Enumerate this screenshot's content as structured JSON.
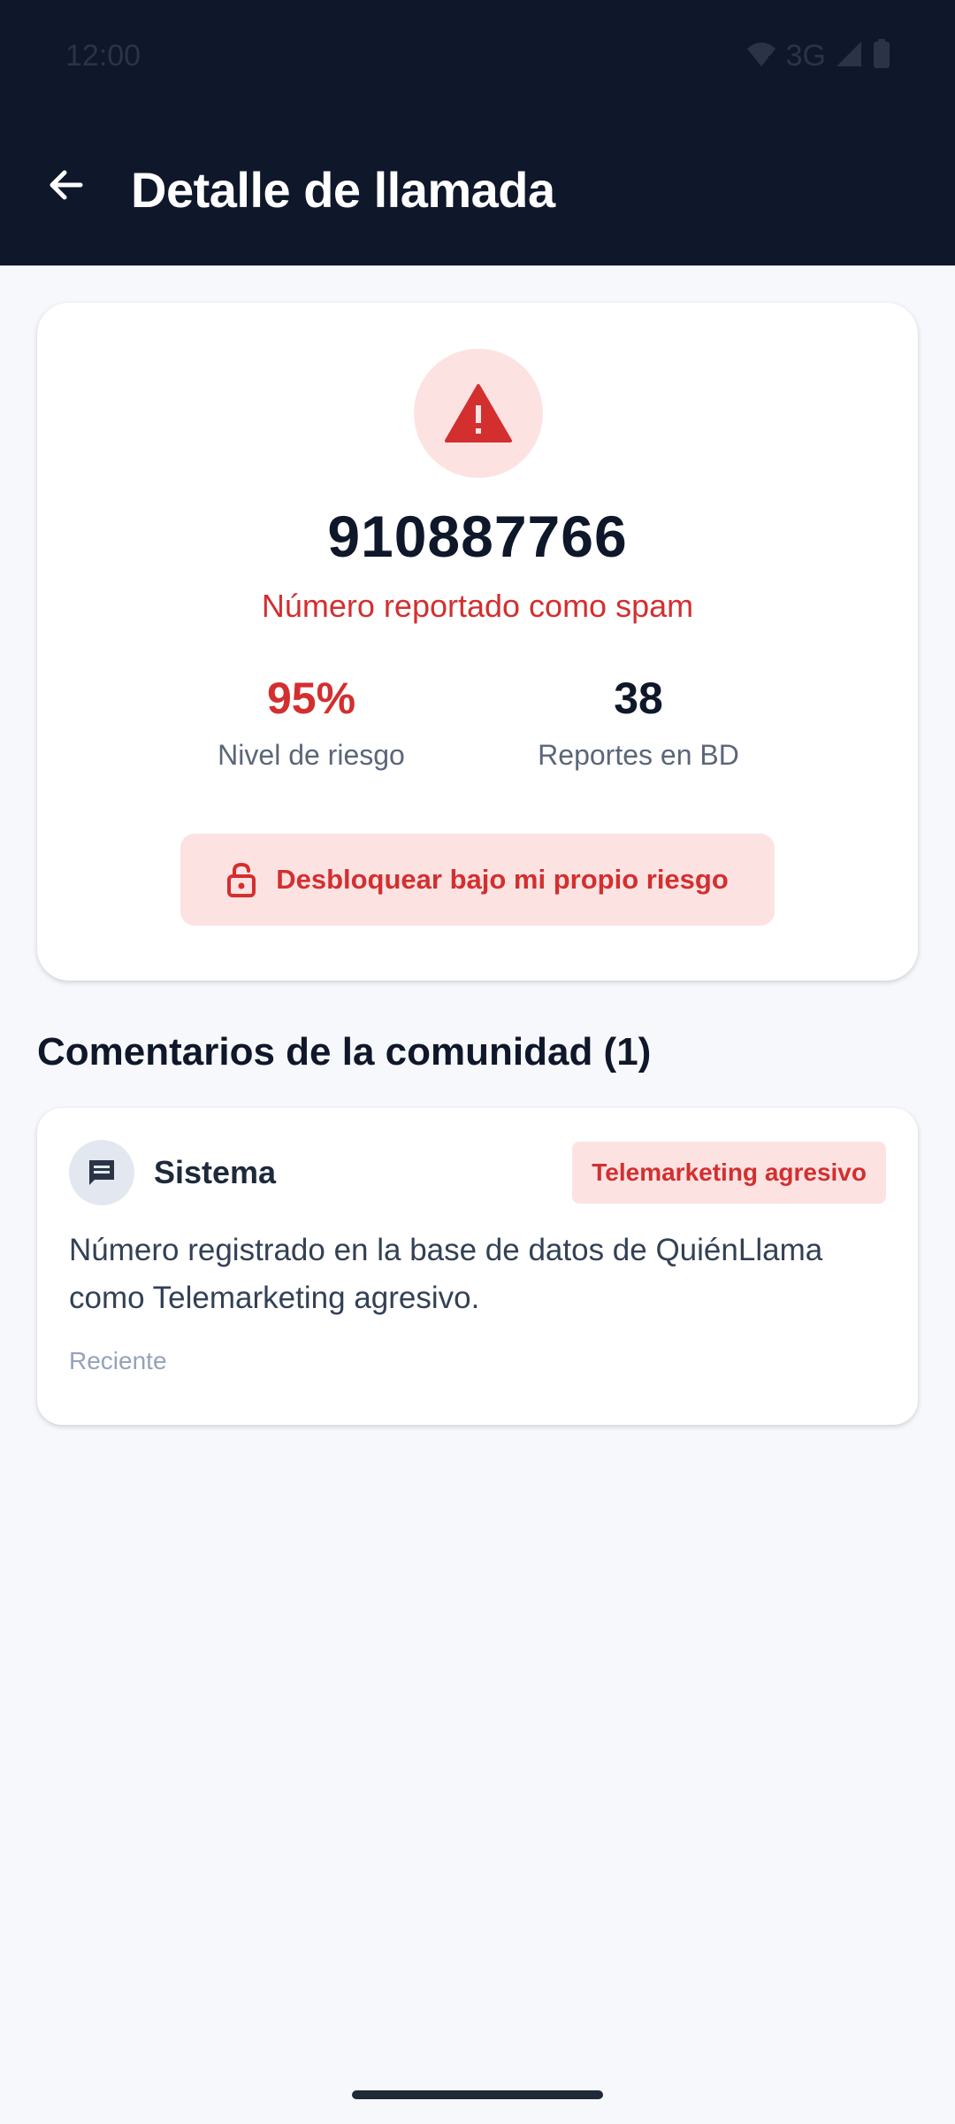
{
  "status_bar": {
    "time": "12:00",
    "network": "3G"
  },
  "app_bar": {
    "title": "Detalle de llamada"
  },
  "call_detail": {
    "phone_number": "910887766",
    "spam_label": "Número reportado como spam",
    "risk_value": "95%",
    "risk_label": "Nivel de riesgo",
    "reports_value": "38",
    "reports_label": "Reportes en BD",
    "unlock_button_label": "Desbloquear bajo mi propio riesgo"
  },
  "comments": {
    "section_title": "Comentarios de la comunidad (1)",
    "items": [
      {
        "author": "Sistema",
        "tag": "Telemarketing agresivo",
        "text": "Número registrado en la base de datos de QuiénLlama como Telemarketing agresivo.",
        "time": "Reciente"
      }
    ]
  },
  "colors": {
    "header_bg": "#0f172a",
    "danger": "#d32f2f",
    "danger_soft": "#fde2e2",
    "page_bg": "#f7f8fc"
  },
  "icons": {
    "back": "arrow-back-icon",
    "alert": "warning-triangle-icon",
    "unlock": "lock-open-icon",
    "comment": "comment-icon",
    "wifi": "wifi-icon",
    "signal": "signal-icon",
    "battery": "battery-icon"
  }
}
